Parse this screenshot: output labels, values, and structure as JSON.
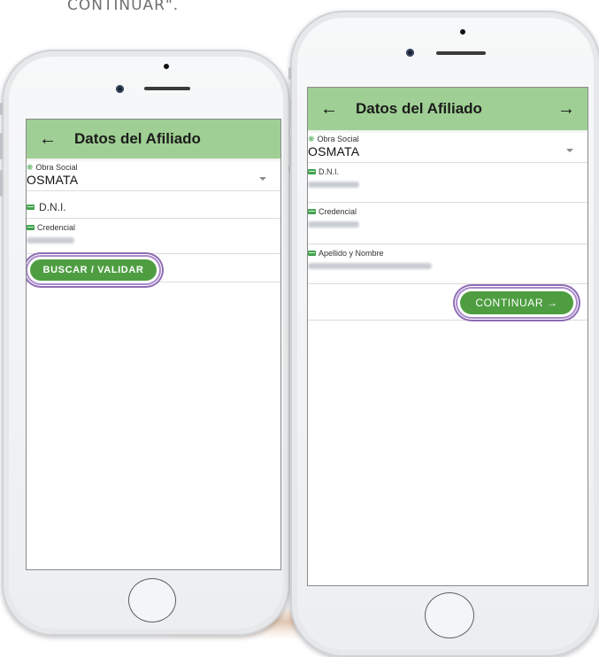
{
  "caption": "CONTINUAR\".",
  "left_screen": {
    "header": {
      "title": "Datos del Afiliado",
      "back_icon": "arrow-left-icon"
    },
    "obra_social": {
      "label": "Obra Social",
      "value": "OSMATA"
    },
    "dni": {
      "label": "D.N.I."
    },
    "credencial": {
      "label": "Credencial"
    },
    "button": {
      "label": "BUSCAR / VALIDAR"
    }
  },
  "right_screen": {
    "header": {
      "title": "Datos del Afiliado",
      "back_icon": "arrow-left-icon",
      "forward_icon": "arrow-right-icon"
    },
    "obra_social": {
      "label": "Obra Social",
      "value": "OSMATA"
    },
    "dni": {
      "label": "D.N.I."
    },
    "credencial": {
      "label": "Credencial"
    },
    "nombre": {
      "label": "Apellido y Nombre"
    },
    "button": {
      "label": "CONTINUAR →"
    }
  },
  "colors": {
    "appbar": "#9fcf94",
    "button": "#4e9e41",
    "highlight": "#8f6bb5"
  }
}
